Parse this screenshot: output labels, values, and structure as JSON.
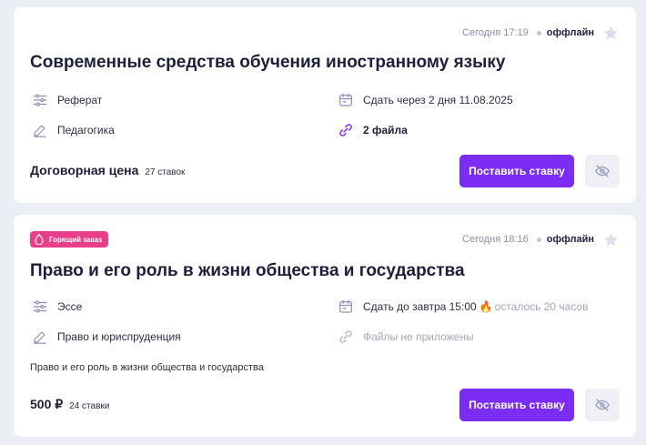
{
  "orders": [
    {
      "time": "Сегодня 17:19",
      "status": "оффлайн",
      "title": "Современные средства обучения иностранному языку",
      "type": "Реферат",
      "deadline": "Сдать через 2 дня 11.08.2025",
      "subject": "Педагогика",
      "files": "2 файла",
      "price": "Договорная цена",
      "bids": "27 ставок",
      "bid_button": "Поставить ставку"
    },
    {
      "badge": "Горящий заказ",
      "time": "Сегодня 18:16",
      "status": "оффлайн",
      "title": "Право и его роль в жизни общества и государства",
      "type": "Эссе",
      "deadline": "Сдать до завтра 15:00",
      "remaining": "осталось 20 часов",
      "subject": "Право и юриспруденция",
      "files": "Файлы не приложены",
      "description": "Право и его роль в жизни общества и государства",
      "price": "500 ₽",
      "bids": "24 ставки",
      "bid_button": "Поставить ставку"
    }
  ],
  "icons": {
    "type": "sliders-icon",
    "deadline": "calendar-icon",
    "subject": "pencil-icon",
    "files": "paperclip-icon",
    "favorite": "star-icon",
    "hide": "eye-off-icon",
    "badge": "flame-drop-icon",
    "fire": "fire-emoji-icon"
  },
  "colors": {
    "accent": "#7b2cf5",
    "hot_badge": "#e83f8a",
    "icon": "#8c90b4",
    "files_icon": "#7b2cf5"
  }
}
